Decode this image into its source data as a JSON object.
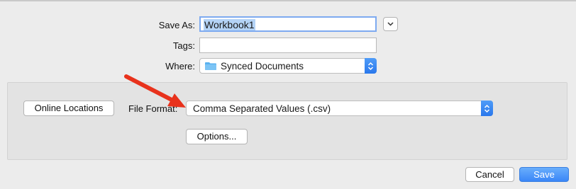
{
  "dialog": {
    "save_as_label": "Save As:",
    "save_as_value": "Workbook1",
    "tags_label": "Tags:",
    "tags_value": "",
    "where_label": "Where:",
    "where_value": "Synced Documents",
    "where_icon": "folder-icon",
    "expand_icon": "chevron-down-icon"
  },
  "options_panel": {
    "online_locations_label": "Online Locations",
    "file_format_label": "File Format:",
    "file_format_value": "Comma Separated Values (.csv)",
    "options_label": "Options..."
  },
  "footer": {
    "cancel_label": "Cancel",
    "save_label": "Save"
  },
  "annotation": {
    "arrow_color": "#e8321c",
    "icon": "red-arrow-icon"
  },
  "colors": {
    "accent": "#3a86f7",
    "selection": "#b4d3f6",
    "folder": "#5ab2f0"
  }
}
